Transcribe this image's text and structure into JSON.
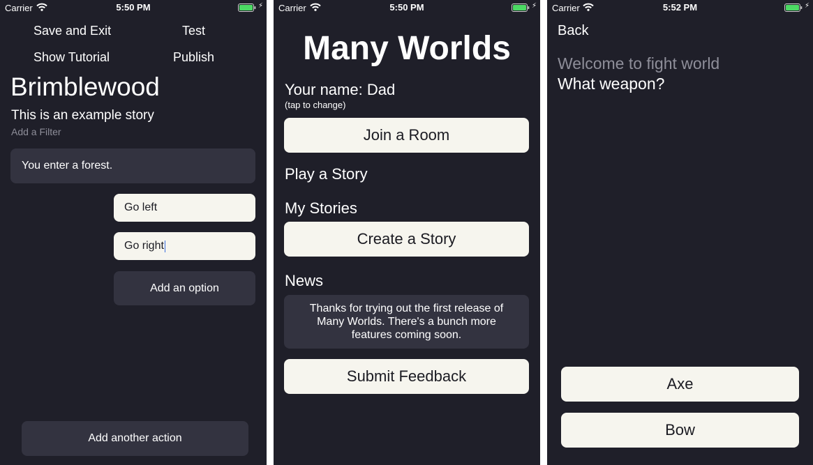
{
  "status_bars": [
    {
      "carrier": "Carrier",
      "time": "5:50 PM"
    },
    {
      "carrier": "Carrier",
      "time": "5:50 PM"
    },
    {
      "carrier": "Carrier",
      "time": "5:52 PM"
    }
  ],
  "editor": {
    "save_exit": "Save and Exit",
    "test": "Test",
    "show_tutorial": "Show Tutorial",
    "publish": "Publish",
    "title": "Brimblewood",
    "description": "This is an example story",
    "filter_placeholder": "Add a Filter",
    "passage": "You enter a forest.",
    "options": [
      "Go left",
      "Go right"
    ],
    "add_option": "Add an option",
    "add_action": "Add another action"
  },
  "home": {
    "app_title": "Many Worlds",
    "your_name": "Your name: Dad",
    "tap_to_change": "(tap to change)",
    "join_room": "Join a Room",
    "play_story": "Play a Story",
    "my_stories": "My Stories",
    "create_story": "Create a Story",
    "news_heading": "News",
    "news_text": "Thanks for trying out the first release of Many Worlds. There's a bunch more features coming soon.",
    "submit_feedback": "Submit Feedback"
  },
  "play": {
    "back": "Back",
    "history_text": "Welcome to fight world",
    "current_text": "What weapon?",
    "choices": [
      "Axe",
      "Bow"
    ]
  },
  "colors": {
    "background": "#1f1f29",
    "light_button": "#f6f5ee",
    "dark_box": "#333340",
    "muted_text": "#8e8e99",
    "battery": "#4cd964",
    "text_cursor": "#3b6fe0"
  },
  "icons": [
    "wifi-icon",
    "battery-icon",
    "charging-bolt-icon"
  ]
}
